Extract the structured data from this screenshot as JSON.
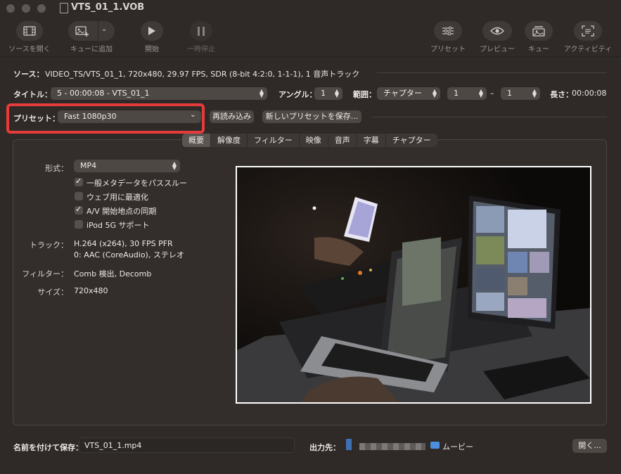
{
  "window": {
    "title": "VTS_01_1.VOB"
  },
  "toolbar": {
    "open_source": "ソースを開く",
    "add_to_queue": "キューに追加",
    "start": "開始",
    "pause": "一時停止",
    "presets": "プリセット",
    "preview": "プレビュー",
    "queue": "キュー",
    "activity": "アクティビティ"
  },
  "source": {
    "label": "ソース：",
    "value": "VIDEO_TS/VTS_01_1, 720x480, 29.97 FPS, SDR (8-bit 4:2:0, 1-1-1), 1 音声トラック"
  },
  "title_row": {
    "title_label": "タイトル：",
    "title_value": "5 - 00:00:08 - VTS_01_1",
    "angle_label": "アングル：",
    "angle_value": "1",
    "range_label": "範囲：",
    "range_type": "チャプター",
    "range_start": "1",
    "range_dash": "–",
    "range_end": "1",
    "duration_label": "長さ：",
    "duration_value": "00:00:08"
  },
  "preset_row": {
    "label": "プリセット：",
    "value": "Fast 1080p30",
    "reload": "再読み込み",
    "save_new": "新しいプリセットを保存..."
  },
  "tabs": [
    "概要",
    "解像度",
    "フィルター",
    "映像",
    "音声",
    "字幕",
    "チャプター"
  ],
  "summary": {
    "format_label": "形式：",
    "format_value": "MP4",
    "options": [
      {
        "label": "一般メタデータをパススルー",
        "checked": true
      },
      {
        "label": "ウェブ用に最適化",
        "checked": false
      },
      {
        "label": "A/V 開始地点の同期",
        "checked": true
      },
      {
        "label": "iPod 5G サポート",
        "checked": false
      }
    ],
    "tracks_label": "トラック：",
    "tracks_line1": "H.264 (x264), 30 FPS PFR",
    "tracks_line2": "0: AAC (CoreAudio), ステレオ",
    "filters_label": "フィルター：",
    "filters_value": "Comb 検出, Decomb",
    "size_label": "サイズ：",
    "size_value": "720x480"
  },
  "bottom": {
    "save_as_label": "名前を付けて保存：",
    "save_as_value": "VTS_01_1.mp4",
    "dest_label": "出力先：",
    "dest_folder": "ムービー",
    "open_button": "開く..."
  }
}
